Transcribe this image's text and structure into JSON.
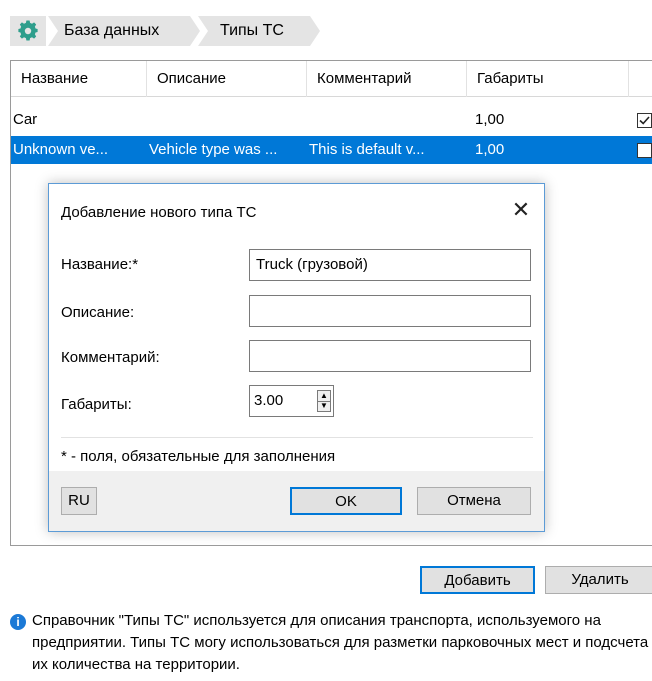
{
  "breadcrumb": {
    "icon": "gear-icon",
    "items": [
      "База данных",
      "Типы ТС"
    ]
  },
  "table": {
    "columns": [
      "Название",
      "Описание",
      "Комментарий",
      "Габариты"
    ],
    "rows": [
      {
        "name": "Car",
        "description": "",
        "comment": "",
        "size": "1,00",
        "checked": true
      },
      {
        "name": "Unknown ve...",
        "description": "Vehicle type was ...",
        "comment": "This is default v...",
        "size": "1,00",
        "checked": false
      }
    ]
  },
  "dialog": {
    "title": "Добавление нового типа ТС",
    "fields": {
      "name_label": "Название:*",
      "name_value": "Truck (грузовой)",
      "description_label": "Описание:",
      "description_value": "",
      "comment_label": "Комментарий:",
      "comment_value": "",
      "size_label": "Габариты:",
      "size_value": "3.00"
    },
    "note": "* - поля, обязательные для заполнения",
    "lang_button": "RU",
    "ok_button": "OK",
    "cancel_button": "Отмена"
  },
  "actions": {
    "add": "Добавить",
    "delete": "Удалить"
  },
  "info": {
    "text": "Справочник \"Типы ТС\" используется для описания транспорта, используемого на предприятии. Типы ТС могу использоваться для разметки парковочных мест и подсчета их количества на территории."
  },
  "colors": {
    "accent": "#0078d7",
    "gear": "#2e9e8c",
    "selection": "#0078d7"
  }
}
